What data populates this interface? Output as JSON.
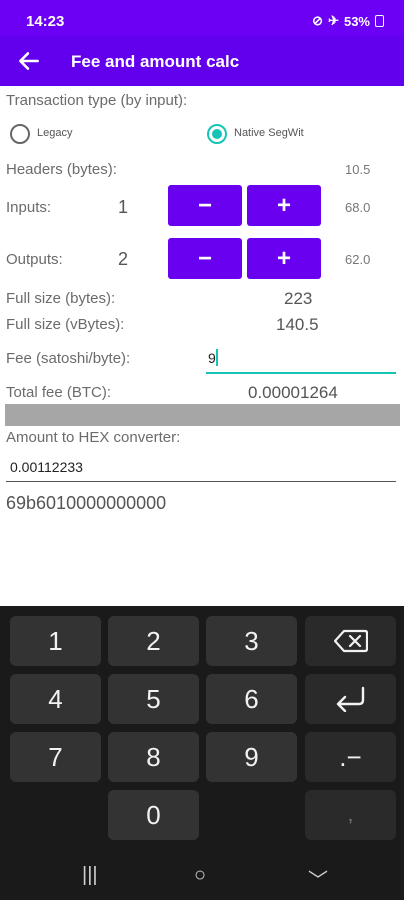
{
  "status": {
    "time": "14:23",
    "battery": "53%"
  },
  "appbar": {
    "title": "Fee and amount calc"
  },
  "tx_type": {
    "label": "Transaction type (by input):",
    "options": [
      {
        "label": "Legacy",
        "selected": false
      },
      {
        "label": "Native SegWit",
        "selected": true
      }
    ]
  },
  "headers": {
    "label": "Headers (bytes):",
    "value": "10.5"
  },
  "inputs": {
    "label": "Inputs:",
    "count": "1",
    "minus": "−",
    "plus": "+",
    "value": "68.0"
  },
  "outputs": {
    "label": "Outputs:",
    "count": "2",
    "minus": "−",
    "plus": "+",
    "value": "62.0"
  },
  "full_size": {
    "label": "Full size (bytes):",
    "value": "223"
  },
  "full_vsize": {
    "label": "Full size (vBytes):",
    "value": "140.5"
  },
  "fee": {
    "label": "Fee (satoshi/byte):",
    "value": "9"
  },
  "total_fee": {
    "label": "Total fee (BTC):",
    "value": "0.00001264"
  },
  "hex": {
    "label": "Amount to HEX converter:",
    "input": "0.00112233",
    "output": "69b6010000000000"
  },
  "keyboard": {
    "keys": [
      "1",
      "2",
      "3",
      "4",
      "5",
      "6",
      "7",
      "8",
      "9",
      "0"
    ],
    "dot_minus": ".−",
    "comma": ","
  },
  "colors": {
    "accent": "#6200ee",
    "teal": "#14c5b6",
    "keyboard_bg": "#1a1a1a"
  }
}
